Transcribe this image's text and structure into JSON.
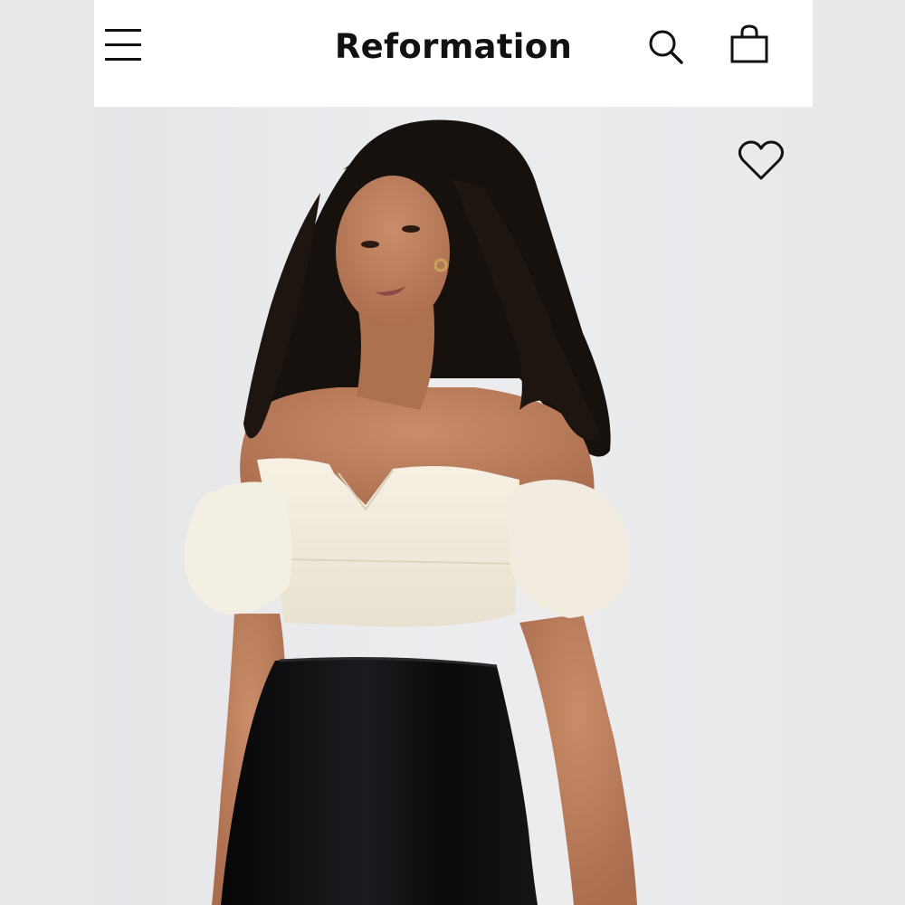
{
  "header": {
    "brand": "Reformation",
    "menu_icon": "hamburger-menu-icon",
    "search_icon": "search-icon",
    "bag_icon": "shopping-bag-icon"
  },
  "product": {
    "image_alt": "",
    "favorite_icon": "heart-outline-icon"
  },
  "colors": {
    "background": "#e9e9ea",
    "header_bg": "#ffffff",
    "text": "#111111",
    "top_ivory": "#f3eee2",
    "skirt_black": "#0e0e10",
    "hair": "#17110d",
    "skin": "#b57a5a"
  }
}
